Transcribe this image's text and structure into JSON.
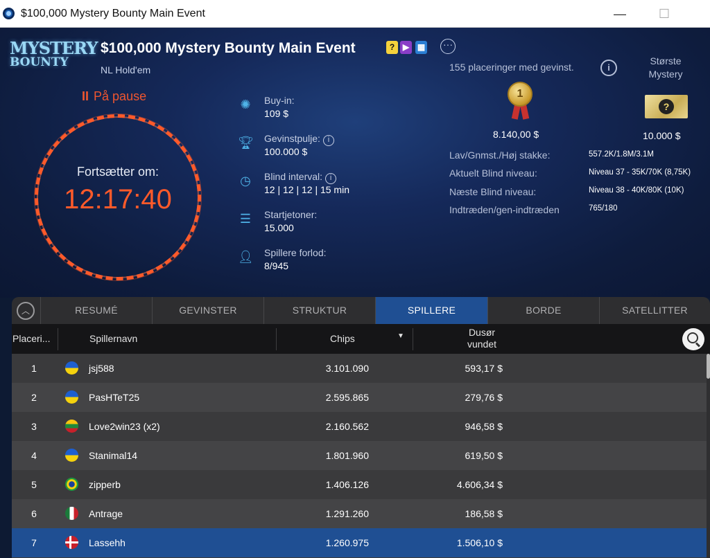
{
  "window": {
    "title": "$100,000 Mystery Bounty Main Event",
    "min_icon": "minimize-icon",
    "max_icon": "maximize-icon",
    "close_icon": "close-icon"
  },
  "logo": {
    "line1": "MYSTERY",
    "line2": "BOUNTY"
  },
  "event": {
    "title": "$100,000 Mystery Bounty Main Event",
    "game_type": "NL Hold'em",
    "badges": [
      {
        "icon": "mystery-question-badge-icon",
        "glyph": "?"
      },
      {
        "icon": "video-badge-icon",
        "glyph": "▶"
      },
      {
        "icon": "calendar-badge-icon",
        "glyph": "▦"
      }
    ],
    "more_glyph": "···"
  },
  "clock": {
    "status": "På pause",
    "status_glyph": "II",
    "resume_label": "Fortsætter om:",
    "time": "12:17:40",
    "accent_color": "#ff5a2a"
  },
  "info": [
    {
      "icon": "poker-chip-icon",
      "label": "Buy-in:",
      "value": "109 $",
      "has_info": false
    },
    {
      "icon": "trophy-icon",
      "label": "Gevinstpulje:",
      "value": "100.000 $",
      "has_info": true
    },
    {
      "icon": "clock-icon",
      "label": "Blind interval:",
      "value": "12 | 12 | 12 | 15 min",
      "has_info": true
    },
    {
      "icon": "chip-stack-icon",
      "label": "Startjetoner:",
      "value": "15.000",
      "has_info": false
    },
    {
      "icon": "player-icon",
      "label": "Spillere forlod:",
      "value": "8/945",
      "has_info": false
    }
  ],
  "prizes": {
    "places_text": "155 placeringer med gevinst.",
    "biggest_label": "Største Mystery",
    "first_prize": "8.140,00 $",
    "first_medal": "1",
    "mystery_prize": "10.000 $",
    "mystery_glyph": "?"
  },
  "stats": [
    {
      "label": "Lav/Gnmst./Høj stakke:",
      "value": "557.2K/1.8M/3.1M"
    },
    {
      "label": "Aktuelt Blind niveau:",
      "value": "Niveau 37 - 35K/70K (8,75K)"
    },
    {
      "label": "Næste Blind niveau:",
      "value": "Niveau 38 - 40K/80K (10K)"
    },
    {
      "label": "Indtræden/gen-indtræden",
      "value": "765/180"
    }
  ],
  "tabs": [
    {
      "label": "RESUMÉ",
      "active": false
    },
    {
      "label": "GEVINSTER",
      "active": false
    },
    {
      "label": "STRUKTUR",
      "active": false
    },
    {
      "label": "SPILLERE",
      "active": true
    },
    {
      "label": "BORDE",
      "active": false
    },
    {
      "label": "SATELLITTER",
      "active": false
    }
  ],
  "table": {
    "headers": {
      "rank": "Placeri...",
      "name": "Spillernavn",
      "chips": "Chips",
      "bounty_line1": "Dusør",
      "bounty_line2": "vundet"
    },
    "sort_glyph": "▼",
    "rows": [
      {
        "rank": "1",
        "name": "jsj588",
        "flag": "ukraine-flag-icon",
        "chips": "3.101.090",
        "bounty": "593,17 $"
      },
      {
        "rank": "2",
        "name": "PasHTeT25",
        "flag": "ukraine-flag-icon",
        "chips": "2.595.865",
        "bounty": "279,76 $"
      },
      {
        "rank": "3",
        "name": "Love2win23 (x2)",
        "flag": "lithuania-flag-icon",
        "chips": "2.160.562",
        "bounty": "946,58 $"
      },
      {
        "rank": "4",
        "name": "Stanimal14",
        "flag": "ukraine-flag-icon",
        "chips": "1.801.960",
        "bounty": "619,50 $"
      },
      {
        "rank": "5",
        "name": "zipperb",
        "flag": "brazil-flag-icon",
        "chips": "1.406.126",
        "bounty": "4.606,34 $"
      },
      {
        "rank": "6",
        "name": "Antrage",
        "flag": "mexico-flag-icon",
        "chips": "1.291.260",
        "bounty": "186,58 $"
      },
      {
        "rank": "7",
        "name": "Lassehh",
        "flag": "denmark-flag-icon",
        "chips": "1.260.975",
        "bounty": "1.506,10 $"
      }
    ],
    "selected_row": 7
  },
  "colors": {
    "header_bg": "#15295a",
    "accent_orange": "#ff5a2a",
    "tab_active": "#1f4f93",
    "icon_blue": "#4fb3e8"
  }
}
